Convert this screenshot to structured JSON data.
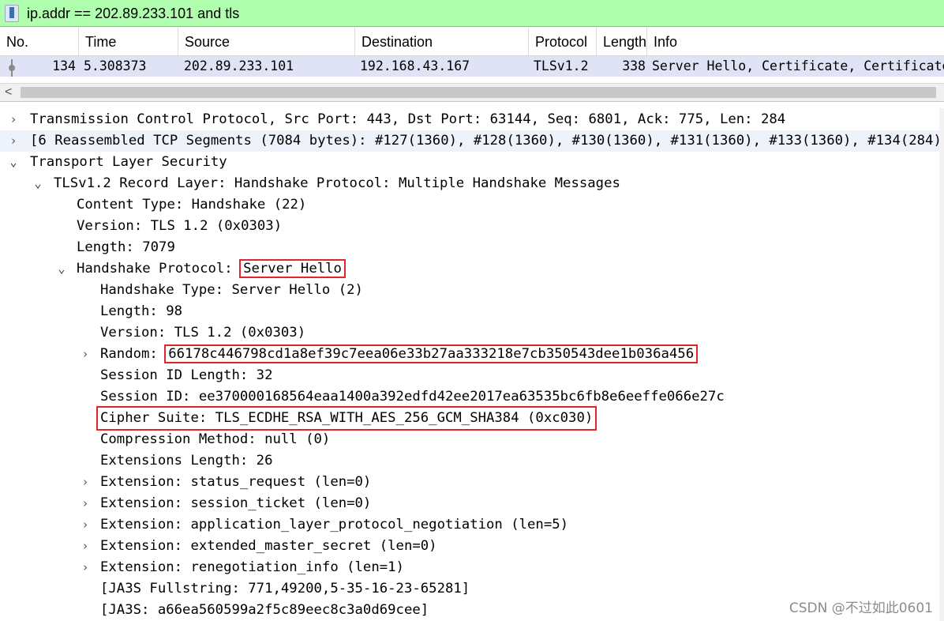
{
  "filter": {
    "text": "ip.addr == 202.89.233.101 and tls"
  },
  "packet_list": {
    "columns": [
      "No.",
      "Time",
      "Source",
      "Destination",
      "Protocol",
      "Length",
      "Info"
    ],
    "rows": [
      {
        "no": "134",
        "time": "5.308373",
        "source": "202.89.233.101",
        "destination": "192.168.43.167",
        "protocol": "TLSv1.2",
        "length": "338",
        "info": "Server Hello, Certificate, Certificate Status, Server Key Exchange, Server Hello Done"
      }
    ]
  },
  "scrollbar": {
    "left_arrow": "<"
  },
  "details": {
    "rows": [
      {
        "arrow": "›",
        "text": "Transmission Control Protocol, Src Port: 443, Dst Port: 63144, Seq: 6801, Ack: 775, Len: 284"
      },
      {
        "arrow": "›",
        "text": "[6 Reassembled TCP Segments (7084 bytes): #127(1360), #128(1360), #130(1360), #131(1360), #133(1360), #134(284)]"
      },
      {
        "arrow": "⌄",
        "text": "Transport Layer Security"
      },
      {
        "arrow": "⌄",
        "text": "TLSv1.2 Record Layer: Handshake Protocol: Multiple Handshake Messages"
      },
      {
        "arrow": "",
        "text": "Content Type: Handshake (22)"
      },
      {
        "arrow": "",
        "text": "Version: TLS 1.2 (0x0303)"
      },
      {
        "arrow": "",
        "text": "Length: 7079"
      },
      {
        "arrow": "⌄",
        "label": "Handshake Protocol: ",
        "value": "Server Hello"
      },
      {
        "arrow": "",
        "text": "Handshake Type: Server Hello (2)"
      },
      {
        "arrow": "",
        "text": "Length: 98"
      },
      {
        "arrow": "",
        "text": "Version: TLS 1.2 (0x0303)"
      },
      {
        "arrow": "›",
        "label": "Random: ",
        "value": "66178c446798cd1a8ef39c7eea06e33b27aa333218e7cb350543dee1b036a456"
      },
      {
        "arrow": "",
        "text": "Session ID Length: 32"
      },
      {
        "arrow": "",
        "text": "Session ID: ee370000168564eaa1400a392edfd42ee2017ea63535bc6fb8e6eeffe066e27c"
      },
      {
        "arrow": "",
        "text": "Cipher Suite: TLS_ECDHE_RSA_WITH_AES_256_GCM_SHA384 (0xc030)"
      },
      {
        "arrow": "",
        "text": "Compression Method: null (0)"
      },
      {
        "arrow": "",
        "text": "Extensions Length: 26"
      },
      {
        "arrow": "›",
        "text": "Extension: status_request (len=0)"
      },
      {
        "arrow": "›",
        "text": "Extension: session_ticket (len=0)"
      },
      {
        "arrow": "›",
        "text": "Extension: application_layer_protocol_negotiation (len=5)"
      },
      {
        "arrow": "›",
        "text": "Extension: extended_master_secret (len=0)"
      },
      {
        "arrow": "›",
        "text": "Extension: renegotiation_info (len=1)"
      },
      {
        "arrow": "",
        "text": "[JA3S Fullstring: 771,49200,5-35-16-23-65281]"
      },
      {
        "arrow": "",
        "text": "[JA3S: a66ea560599a2f5c89eec8c3a0d69cee]"
      }
    ]
  },
  "watermark": "CSDN @不过如此0601",
  "colors": {
    "filter_bg": "#afffaf",
    "selected_row_bg": "#e0e3f5",
    "highlight_box": "#e0262b"
  }
}
